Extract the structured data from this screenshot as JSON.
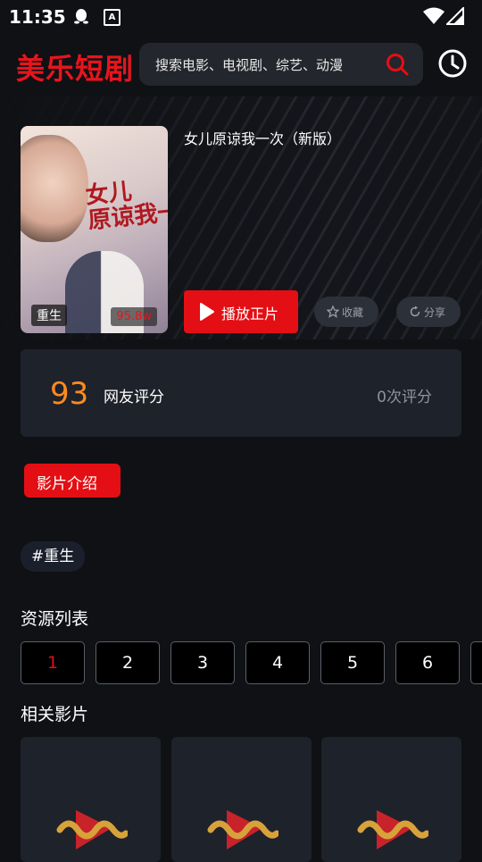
{
  "status_bar": {
    "time": "11:35",
    "a_label": "A"
  },
  "header": {
    "logo": "美乐短剧",
    "search_placeholder": "搜索电影、电视剧、综艺、动漫"
  },
  "movie": {
    "title": "女儿原谅我一次（新版）",
    "poster_title": "女儿\n原谅我一次",
    "poster_tag": "重生",
    "views": "95.8w",
    "play_label": "播放正片",
    "favorite_label": "收藏",
    "share_label": "分享"
  },
  "rating": {
    "score": "93",
    "label": "网友评分",
    "count": "0次评分"
  },
  "intro_label": "影片介绍",
  "hashtag": "#重生",
  "resources": {
    "title": "资源列表",
    "episodes": [
      "1",
      "2",
      "3",
      "4",
      "5",
      "6"
    ]
  },
  "related": {
    "title": "相关影片"
  },
  "colors": {
    "accent": "#e30f14",
    "score": "#ff8a1f",
    "card": "#1e222b",
    "background": "#0f1115"
  }
}
